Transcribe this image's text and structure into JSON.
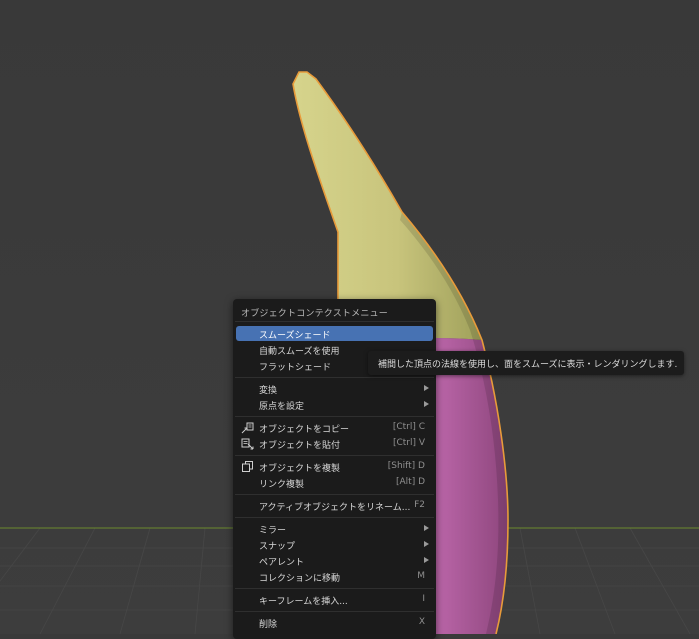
{
  "menu": {
    "title": "オブジェクトコンテクストメニュー",
    "items": [
      {
        "label": "スムーズシェード",
        "shortcut": ""
      },
      {
        "label": "自動スムーズを使用",
        "shortcut": ""
      },
      {
        "label": "フラットシェード",
        "shortcut": ""
      },
      {
        "label": "変換",
        "shortcut": ""
      },
      {
        "label": "原点を設定",
        "shortcut": ""
      },
      {
        "label": "オブジェクトをコピー",
        "shortcut": "[Ctrl] C",
        "icon": "copy-icon"
      },
      {
        "label": "オブジェクトを貼付",
        "shortcut": "[Ctrl] V",
        "icon": "paste-icon"
      },
      {
        "label": "オブジェクトを複製",
        "shortcut": "[Shift] D",
        "icon": "duplicate-icon"
      },
      {
        "label": "リンク複製",
        "shortcut": "[Alt] D"
      },
      {
        "label": "アクティブオブジェクトをリネーム...",
        "shortcut": "F2"
      },
      {
        "label": "ミラー",
        "shortcut": ""
      },
      {
        "label": "スナップ",
        "shortcut": ""
      },
      {
        "label": "ペアレント",
        "shortcut": ""
      },
      {
        "label": "コレクションに移動",
        "shortcut": "M"
      },
      {
        "label": "キーフレームを挿入...",
        "shortcut": "I"
      },
      {
        "label": "削除",
        "shortcut": "X"
      }
    ]
  },
  "tooltip": {
    "text": "補間した頂点の法線を使用し、面をスムーズに表示・レンダリングします."
  },
  "colors": {
    "highlight": "#4772b3",
    "menu_bg": "#1b1b1b",
    "viewport_bg": "#3a3a3a",
    "selection_outline": "#e89b3a",
    "mesh_top": "#c6c37a",
    "mesh_bottom": "#b5629f"
  }
}
